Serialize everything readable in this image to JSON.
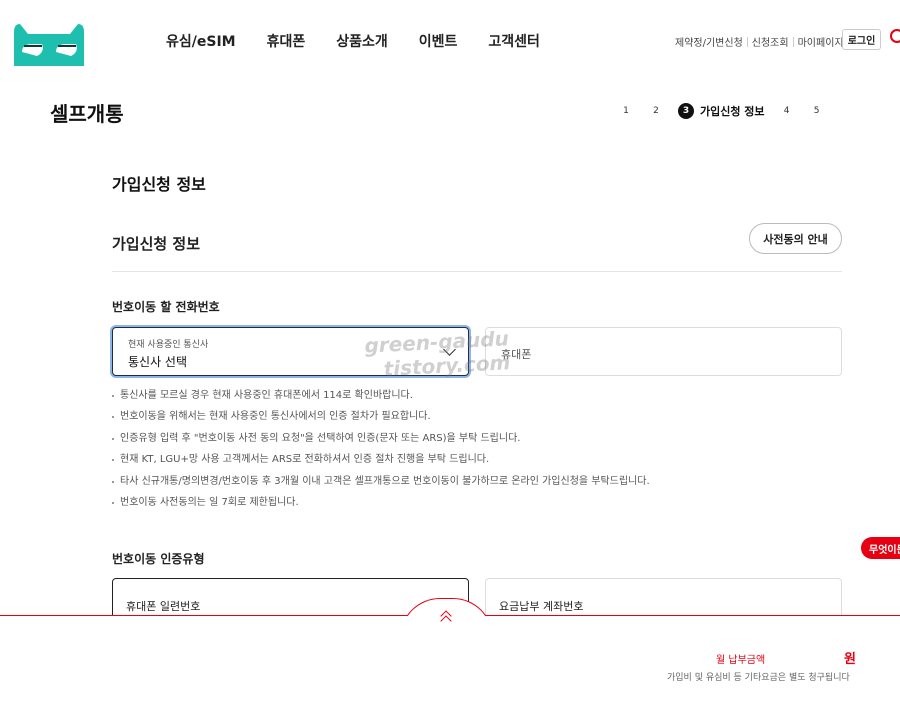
{
  "header": {
    "nav": [
      "유심/eSIM",
      "휴대폰",
      "상품소개",
      "이벤트",
      "고객센터"
    ],
    "util_links": [
      "제약정/기변신청",
      "신청조회",
      "마이페이지"
    ],
    "login_label": "로그인"
  },
  "page": {
    "title": "셀프개통",
    "steps": [
      "1",
      "2",
      "3",
      "4",
      "5"
    ],
    "current_step": "3",
    "current_step_label": "가입신청 정보"
  },
  "section": {
    "title": "가입신청 정보",
    "subtitle": "가입신청 정보",
    "guide_button": "사전동의 안내"
  },
  "transfer": {
    "label": "번호이동 할 전화번호",
    "carrier_small_label": "현재 사용중인 통신사",
    "carrier_value": "통신사 선택",
    "phone_placeholder": "휴대폰",
    "notes": [
      "통신사를 모르실 경우 현재 사용중인 휴대폰에서 114로 확인바랍니다.",
      "번호이동을 위해서는 현재 사용중인 통신사에서의 인증 절차가 필요합니다.",
      "인증유형 입력 후 \"번호이동 사전 동의 요청\"을 선택하여 인증(문자 또는 ARS)을 부탁 드립니다.",
      "현재 KT, LGU+망 사용 고객께서는 ARS로 전화하셔서 인증 절차 진행을 부탁 드립니다.",
      "타사 신규개통/명의변경/번호이동 후 3개월 이내 고객은 셀프개통으로 번호이동이 불가하므로 온라인 가입신청을 부탁드립니다.",
      "번호이동 사전동의는 일 7회로 제한됩니다."
    ]
  },
  "auth": {
    "label": "번호이동 인증유형",
    "option_a": "휴대폰 일련번호",
    "option_b": "요금납부 계좌번호"
  },
  "floating_chip": "무엇이든",
  "bottom": {
    "pay_label": "월 납부금액",
    "pay_value": "원",
    "pay_note": "가입비 및 유심비 등 기타요금은 별도 청구됩니다"
  },
  "watermark": [
    "green-gaudu",
    "tistory.com"
  ],
  "colors": {
    "accent": "#e60012",
    "logo": "#1fbfb0",
    "focus_border": "#1e2a4a"
  }
}
